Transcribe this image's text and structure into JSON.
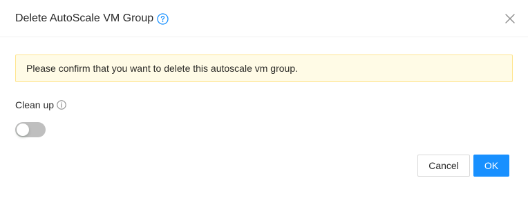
{
  "dialog": {
    "title": "Delete AutoScale VM Group",
    "help_icon": "question-circle-icon",
    "close_icon": "close-icon"
  },
  "alert": {
    "message": "Please confirm that you want to delete this autoscale vm group.",
    "type": "warning"
  },
  "cleanup": {
    "label": "Clean up",
    "info_icon": "info-circle-icon",
    "enabled": false
  },
  "footer": {
    "cancel_label": "Cancel",
    "ok_label": "OK"
  },
  "colors": {
    "primary": "#1890ff",
    "alert_background": "#fffbe6",
    "alert_border": "#ffe58f",
    "switch_off": "#bfbfbf"
  }
}
